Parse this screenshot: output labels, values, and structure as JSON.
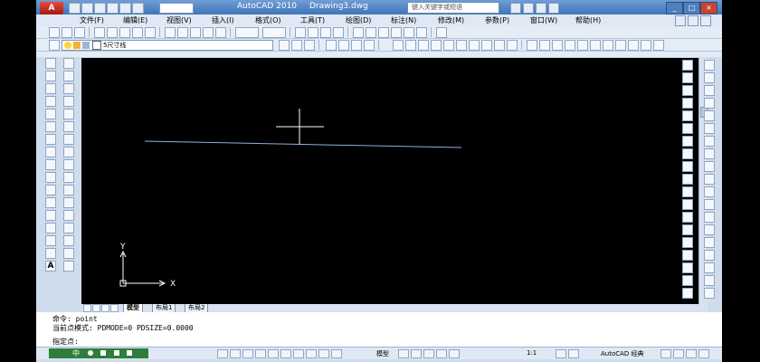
{
  "window": {
    "logo": "A",
    "app_title": "AutoCAD 2010",
    "doc_title": "Drawing3.dwg",
    "search_placeholder": "键入关键字或短语",
    "controls": [
      "_",
      "□",
      "×"
    ]
  },
  "menu": [
    "文件(F)",
    "编辑(E)",
    "视图(V)",
    "插入(I)",
    "格式(O)",
    "工具(T)",
    "绘图(D)",
    "标注(N)",
    "修改(M)",
    "参数(P)",
    "窗口(W)",
    "帮助(H)"
  ],
  "layer_toolbar": {
    "layer_value": "5尺寸线"
  },
  "left_toolbar": {
    "text_tool": "A"
  },
  "canvas": {
    "background": "#000000",
    "line_color": "#8fb0d9",
    "ucs_x": "X",
    "ucs_y": "Y"
  },
  "layout_tabs": [
    "模型",
    "布局1",
    "布局2"
  ],
  "command_lines": [
    "命令:  point",
    "当前点模式:  PDMODE=0  PDSIZE=0.0000",
    "指定点:"
  ],
  "status": {
    "ime_text": "中",
    "model_label": "模型",
    "scale": "1:1",
    "workspace": "AutoCAD 经典"
  }
}
